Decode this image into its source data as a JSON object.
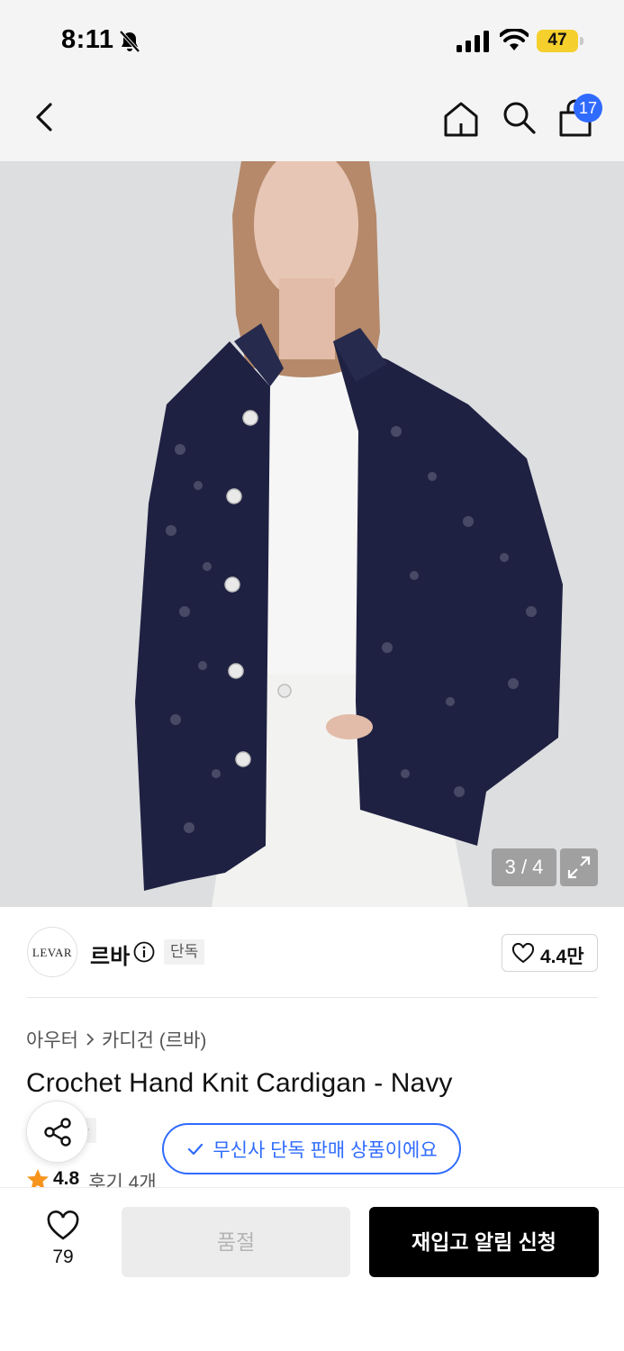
{
  "status_bar": {
    "time": "8:11",
    "battery": "47",
    "icons": [
      "bell-off-icon",
      "signal-icon",
      "wifi-icon",
      "battery-icon"
    ],
    "battery_color": "#f5cf2c"
  },
  "nav": {
    "icons": [
      "back-icon",
      "home-icon",
      "search-icon",
      "shopping-bag-icon"
    ],
    "cart_count": "17",
    "badge_color": "#2f6bff"
  },
  "gallery": {
    "counter": "3 / 4",
    "expand_icon": "expand-icon"
  },
  "brand": {
    "logo_text": "LEVAR",
    "name": "르바",
    "exclusive_label": "단독",
    "likes": "4.4만"
  },
  "product": {
    "breadcrumb": [
      "아우터",
      "카디건 (르바)"
    ],
    "title": "Crochet Hand Knit Cardigan - Navy",
    "tag": "단독",
    "rating": "4.8",
    "reviews": "후기 4개"
  },
  "toast": {
    "text": "무신사 단독 판매 상품이에요",
    "color": "#2f6bff"
  },
  "bottom_bar": {
    "wish_count": "79",
    "soldout_label": "품절",
    "restock_label": "재입고 알림 신청"
  }
}
